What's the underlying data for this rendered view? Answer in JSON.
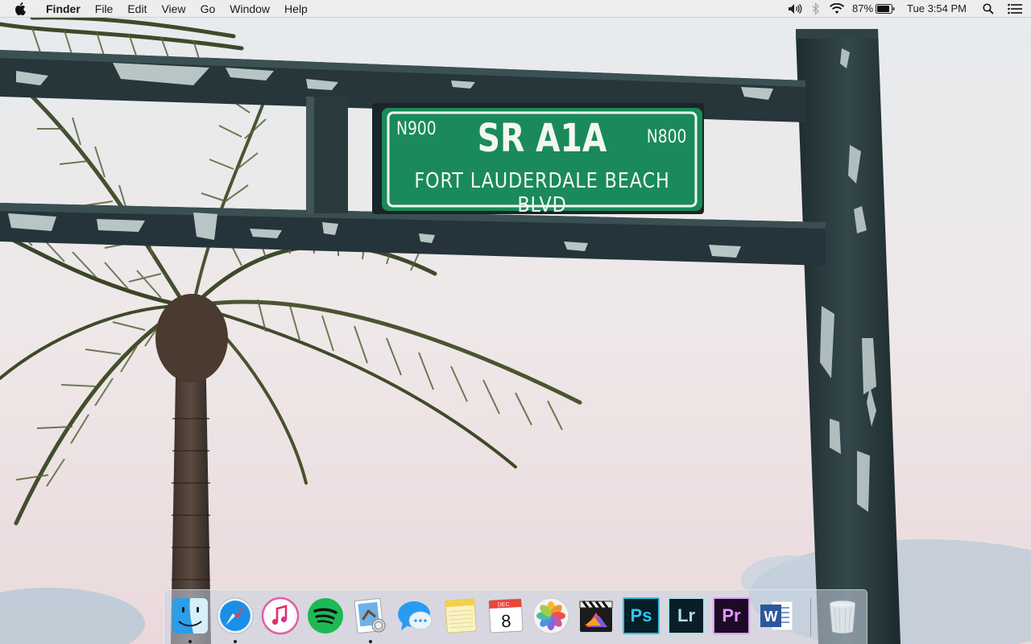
{
  "menubar": {
    "app_name": "Finder",
    "menus": [
      "File",
      "Edit",
      "View",
      "Go",
      "Window",
      "Help"
    ],
    "battery": "87%",
    "clock": "Tue 3:54 PM",
    "icons": [
      "apple-icon",
      "volume-icon",
      "bluetooth-icon",
      "wifi-icon",
      "battery-icon",
      "spotlight-icon",
      "notification-center-icon"
    ]
  },
  "wallpaper": {
    "sign": {
      "left_number": "N900",
      "right_number": "N800",
      "route": "SR A1A",
      "street": "FORT LAUDERDALE BEACH BLVD"
    }
  },
  "dock": {
    "apps": [
      {
        "name": "Finder",
        "running": true
      },
      {
        "name": "Safari",
        "running": true
      },
      {
        "name": "iTunes",
        "running": false
      },
      {
        "name": "Spotify",
        "running": false
      },
      {
        "name": "Preview",
        "running": true
      },
      {
        "name": "Messages",
        "running": false
      },
      {
        "name": "Notes",
        "running": false
      },
      {
        "name": "Calendar",
        "running": false,
        "month": "DEC",
        "day": "8"
      },
      {
        "name": "Photos",
        "running": false
      },
      {
        "name": "Final Cut Pro",
        "running": false
      },
      {
        "name": "Photoshop",
        "running": false,
        "label": "Ps"
      },
      {
        "name": "Lightroom",
        "running": false,
        "label": "Lr"
      },
      {
        "name": "Premiere Pro",
        "running": false,
        "label": "Pr"
      },
      {
        "name": "Microsoft Word",
        "running": false,
        "label": "W"
      },
      {
        "name": "Trash",
        "running": false
      }
    ]
  },
  "colors": {
    "sign_green": "#1a8a5a",
    "post": "#253538",
    "photoshop": "#31c5f0",
    "lightroom": "#aee0ee",
    "premiere": "#e09afc",
    "word": "#2b579a",
    "spotify": "#1db954"
  }
}
